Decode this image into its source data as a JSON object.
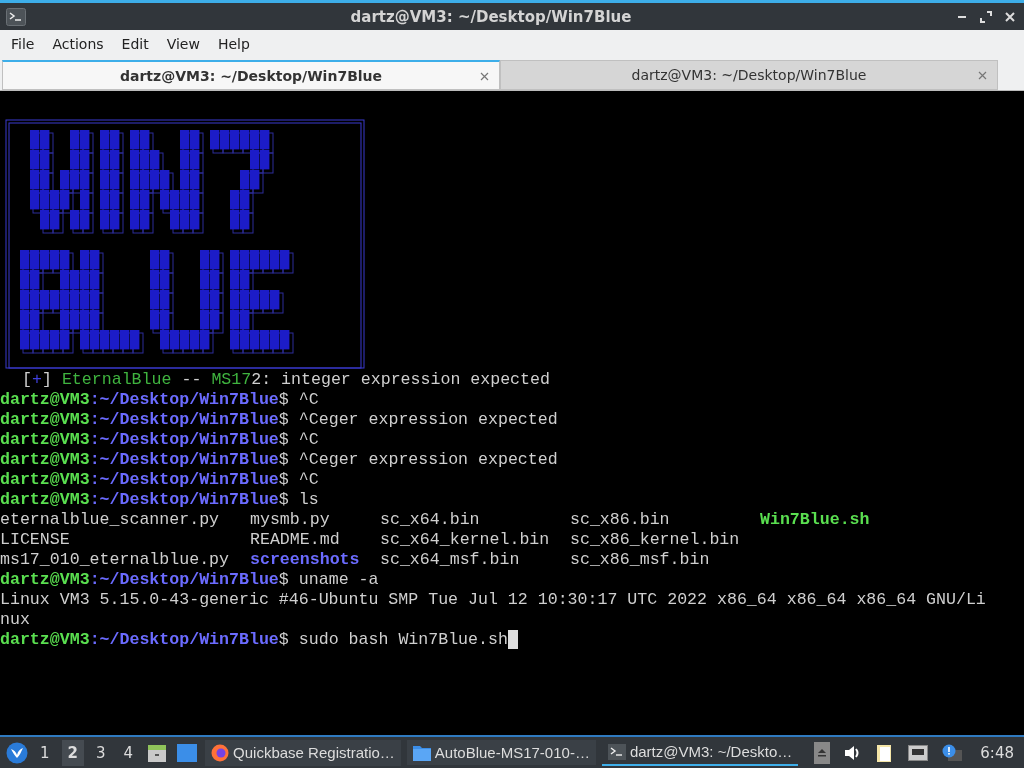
{
  "window": {
    "title": "dartz@VM3: ~/Desktop/Win7Blue"
  },
  "menu": [
    "File",
    "Actions",
    "Edit",
    "View",
    "Help"
  ],
  "tabs": [
    {
      "label": "dartz@VM3: ~/Desktop/Win7Blue",
      "selected": true
    },
    {
      "label": "dartz@VM3: ~/Desktop/Win7Blue",
      "selected": false
    }
  ],
  "terminal": {
    "lines": [
      {
        "kind": "banner",
        "segments": [
          {
            "text": "[",
            "kind": "plain"
          },
          {
            "text": "+",
            "kind": "accent"
          },
          {
            "text": "]",
            "kind": "plain"
          },
          {
            "text": "EternalBlue",
            "kind": "highlight"
          },
          {
            "text": "--",
            "kind": "plain"
          },
          {
            "text": "MS17",
            "kind": "highlight"
          },
          {
            "text": "2: integer expression expected",
            "kind": "plain"
          }
        ]
      },
      {
        "kind": "prompt",
        "user": "dartz@VM3",
        "path": ":~/Desktop/Win7Blue",
        "symbol": "$",
        "command": "^C"
      },
      {
        "kind": "prompt",
        "user": "dartz@VM3",
        "path": ":~/Desktop/Win7Blue",
        "symbol": "$",
        "command": "^Ceger expression expected"
      },
      {
        "kind": "prompt",
        "user": "dartz@VM3",
        "path": ":~/Desktop/Win7Blue",
        "symbol": "$",
        "command": "^C"
      },
      {
        "kind": "prompt",
        "user": "dartz@VM3",
        "path": ":~/Desktop/Win7Blue",
        "symbol": "$",
        "command": "^Ceger expression expected"
      },
      {
        "kind": "prompt",
        "user": "dartz@VM3",
        "path": ":~/Desktop/Win7Blue",
        "symbol": "$",
        "command": "^C"
      },
      {
        "kind": "prompt",
        "user": "dartz@VM3",
        "path": ":~/Desktop/Win7Blue",
        "symbol": "$",
        "command": "ls"
      },
      {
        "kind": "listing",
        "rows": [
          [
            {
              "name": "eternalblue_scanner.py",
              "kind": "file"
            },
            {
              "name": "mysmb.py",
              "kind": "file"
            },
            {
              "name": "sc_x64.bin",
              "kind": "file"
            },
            {
              "name": "sc_x86.bin",
              "kind": "file"
            },
            {
              "name": "Win7Blue.sh",
              "kind": "executable"
            }
          ],
          [
            {
              "name": "LICENSE",
              "kind": "file"
            },
            {
              "name": "README.md",
              "kind": "file"
            },
            {
              "name": "sc_x64_kernel.bin",
              "kind": "file"
            },
            {
              "name": "sc_x86_kernel.bin",
              "kind": "file"
            }
          ],
          [
            {
              "name": "ms17_010_eternalblue.py",
              "kind": "file"
            },
            {
              "name": "screenshots",
              "kind": "directory"
            },
            {
              "name": "sc_x64_msf.bin",
              "kind": "file"
            },
            {
              "name": "sc_x86_msf.bin",
              "kind": "file"
            }
          ]
        ]
      },
      {
        "kind": "prompt",
        "user": "dartz@VM3",
        "path": ":~/Desktop/Win7Blue",
        "symbol": "$",
        "command": "uname -a"
      },
      {
        "kind": "output",
        "text": "Linux VM3 5.15.0-43-generic #46-Ubuntu SMP Tue Jul 12 10:30:17 UTC 2022 x86_64 x86_64 x86_64 GNU/Li"
      },
      {
        "kind": "output",
        "text": "nux"
      },
      {
        "kind": "prompt",
        "user": "dartz@VM3",
        "path": ":~/Desktop/Win7Blue",
        "symbol": "$",
        "command": "sudo bash Win7Blue.sh",
        "cursor": true
      }
    ]
  },
  "taskbar": {
    "workspaces": [
      {
        "label": "1",
        "selected": false
      },
      {
        "label": "2",
        "selected": true
      },
      {
        "label": "3",
        "selected": false
      },
      {
        "label": "4",
        "selected": false
      }
    ],
    "tasks": [
      {
        "label": "Quickbase Registratio…",
        "kind": "browser",
        "selected": false
      },
      {
        "label": "AutoBlue-MS17-010-…",
        "kind": "folder",
        "selected": false
      },
      {
        "label": "dartz@VM3: ~/Deskto…",
        "kind": "terminal",
        "selected": true
      }
    ],
    "clock": "6:48"
  }
}
